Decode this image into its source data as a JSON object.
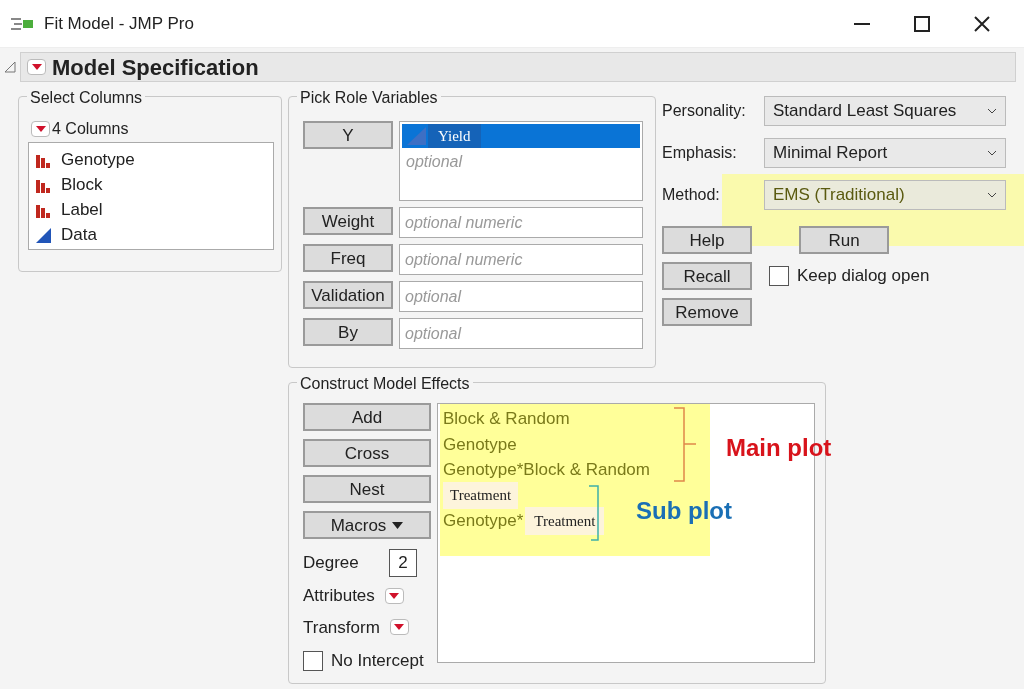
{
  "window": {
    "title": "Fit Model - JMP Pro"
  },
  "section": {
    "title": "Model Specification",
    "expanded": true
  },
  "select_columns": {
    "title": "Select Columns",
    "count_label": "4 Columns",
    "columns": [
      {
        "name": "Genotype",
        "kind": "nominal"
      },
      {
        "name": "Block",
        "kind": "nominal"
      },
      {
        "name": "Label",
        "kind": "nominal"
      },
      {
        "name": "Data",
        "kind": "continuous"
      }
    ]
  },
  "pick_roles": {
    "title": "Pick Role Variables",
    "roles": [
      {
        "button": "Y",
        "kind": "list",
        "items": [
          {
            "name": "Yield",
            "selected": true
          }
        ],
        "placeholder": "optional"
      },
      {
        "button": "Weight",
        "kind": "field",
        "placeholder": "optional numeric"
      },
      {
        "button": "Freq",
        "kind": "field",
        "placeholder": "optional numeric"
      },
      {
        "button": "Validation",
        "kind": "field",
        "placeholder": "optional"
      },
      {
        "button": "By",
        "kind": "field",
        "placeholder": "optional"
      }
    ]
  },
  "settings": [
    {
      "label": "Personality:",
      "value": "Standard Least Squares",
      "highlighted": false
    },
    {
      "label": "Emphasis:",
      "value": "Minimal Report",
      "highlighted": false
    },
    {
      "label": "Method:",
      "value": "EMS (Traditional)",
      "highlighted": true
    }
  ],
  "action_buttons": [
    "Help",
    "Run",
    "Recall",
    "Remove"
  ],
  "keep_dialog_open": {
    "label": "Keep dialog open",
    "checked": false
  },
  "construct": {
    "title": "Construct Model Effects",
    "buttons": [
      "Add",
      "Cross",
      "Nest",
      "Macros"
    ],
    "degree": {
      "label": "Degree",
      "value": "2"
    },
    "attributes_label": "Attributes",
    "transform_label": "Transform",
    "no_intercept": {
      "label": "No Intercept",
      "checked": false
    },
    "effects": [
      {
        "kind": "plain",
        "text": "Block & Random"
      },
      {
        "kind": "plain",
        "text": "Genotype"
      },
      {
        "kind": "plain",
        "text": "Genotype*Block & Random"
      },
      {
        "kind": "patch",
        "text": "Treatment"
      },
      {
        "kind": "mixed",
        "text": "Genotype*",
        "patch": "Treatment"
      }
    ]
  },
  "annotations": {
    "main_label": "Main plot",
    "sub_label": "Sub plot"
  }
}
